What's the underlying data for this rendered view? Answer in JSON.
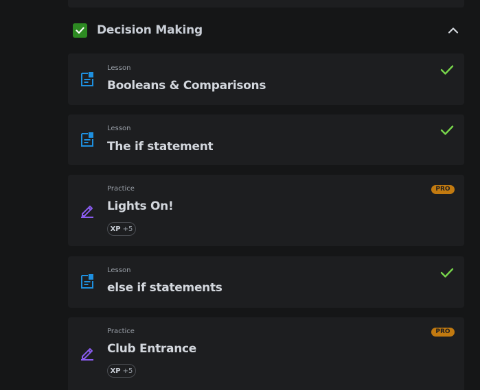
{
  "section": {
    "title": "Decision Making",
    "completed": true,
    "expanded": true
  },
  "items": [
    {
      "type": "Lesson",
      "title": "Booleans & Comparisons",
      "icon": "lesson-document-icon",
      "status": "completed"
    },
    {
      "type": "Lesson",
      "title": "The if statement",
      "icon": "lesson-document-icon",
      "status": "completed"
    },
    {
      "type": "Practice",
      "title": "Lights On!",
      "icon": "practice-pencil-icon",
      "badge": "PRO",
      "xp_label": "XP",
      "xp_value": "+5"
    },
    {
      "type": "Lesson",
      "title": "else if statements",
      "icon": "lesson-document-icon",
      "status": "completed"
    },
    {
      "type": "Practice",
      "title": "Club Entrance",
      "icon": "practice-pencil-icon",
      "badge": "PRO",
      "xp_label": "XP",
      "xp_value": "+5"
    }
  ],
  "colors": {
    "background": "#151617",
    "card": "#1d1e20",
    "lesson_icon": "#1e90e0",
    "practice_icon": "#8a5cf0",
    "check": "#78d64b",
    "pro_badge": "#c27a10",
    "section_check": "#2d8a22"
  }
}
